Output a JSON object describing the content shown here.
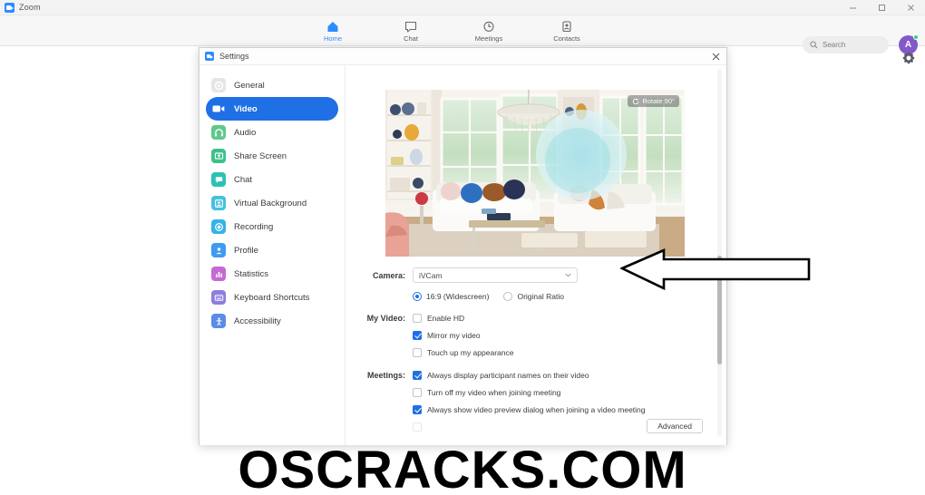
{
  "os_window": {
    "title": "Zoom",
    "app_icon": "zoom-icon",
    "minimize": "–",
    "maximize": "☐",
    "close": "✕"
  },
  "topnav": {
    "items": [
      {
        "label": "Home",
        "icon": "home-icon",
        "active": true
      },
      {
        "label": "Chat",
        "icon": "chat-bubble-icon",
        "active": false
      },
      {
        "label": "Meetings",
        "icon": "clock-icon",
        "active": false
      },
      {
        "label": "Contacts",
        "icon": "contact-card-icon",
        "active": false
      }
    ],
    "search": {
      "placeholder": "Search",
      "icon": "search-icon"
    },
    "avatar": {
      "initial": "A",
      "status": "available",
      "color": "#8359c9",
      "status_color": "#2bd97c"
    },
    "gear": "gear-icon"
  },
  "dialog": {
    "title": "Settings",
    "icon": "zoom-icon",
    "close": "✕",
    "sidebar": [
      {
        "label": "General",
        "icon": "gear-icon",
        "color": "#e3e3e3",
        "active": false
      },
      {
        "label": "Video",
        "icon": "video-camera-icon",
        "color": "#1f6fe5",
        "active": true
      },
      {
        "label": "Audio",
        "icon": "headphones-icon",
        "color": "#5ec98a",
        "active": false
      },
      {
        "label": "Share Screen",
        "icon": "share-screen-icon",
        "color": "#3cc18a",
        "active": false
      },
      {
        "label": "Chat",
        "icon": "chat-bubble-icon",
        "color": "#2cc2b2",
        "active": false
      },
      {
        "label": "Virtual Background",
        "icon": "person-frame-icon",
        "color": "#46c0dd",
        "active": false
      },
      {
        "label": "Recording",
        "icon": "record-dot-icon",
        "color": "#34b3e8",
        "active": false
      },
      {
        "label": "Profile",
        "icon": "person-icon",
        "color": "#3e9bf0",
        "active": false
      },
      {
        "label": "Statistics",
        "icon": "bar-chart-icon",
        "color": "#c569d4",
        "active": false
      },
      {
        "label": "Keyboard Shortcuts",
        "icon": "keyboard-icon",
        "color": "#8d7fe0",
        "active": false
      },
      {
        "label": "Accessibility",
        "icon": "accessibility-icon",
        "color": "#5b8ce8",
        "active": false
      }
    ],
    "preview": {
      "rotate_label": "Rotate 90°",
      "rotate_icon": "rotate-icon",
      "scene": "living-room-video-preview"
    },
    "form": {
      "camera_label": "Camera:",
      "camera_value": "iVCam",
      "camera_chevron": "chevron-down-icon",
      "aspect_options": [
        {
          "label": "16:9 (Widescreen)",
          "selected": true
        },
        {
          "label": "Original Ratio",
          "selected": false
        }
      ],
      "my_video_label": "My Video:",
      "my_video_options": [
        {
          "label": "Enable HD",
          "checked": false
        },
        {
          "label": "Mirror my video",
          "checked": true
        },
        {
          "label": "Touch up my appearance",
          "checked": false
        }
      ],
      "meetings_label": "Meetings:",
      "meetings_options": [
        {
          "label": "Always display participant names on their video",
          "checked": true
        },
        {
          "label": "Turn off my video when joining meeting",
          "checked": false
        },
        {
          "label": "Always show video preview dialog when joining a video meeting",
          "checked": true
        }
      ]
    },
    "advanced_label": "Advanced"
  },
  "annotation": {
    "arrow": "left-pointing-arrow-annotation"
  },
  "watermark": {
    "text": "OSCRACKS.COM"
  }
}
